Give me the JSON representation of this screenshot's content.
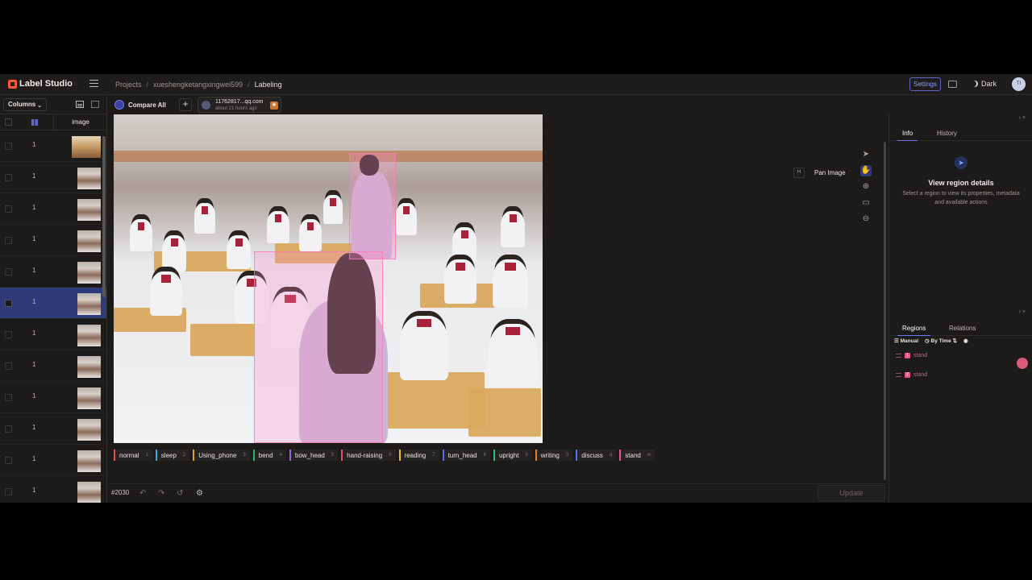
{
  "app": {
    "name": "Label Studio"
  },
  "breadcrumbs": [
    "Projects",
    "xueshengketangxingwei599",
    "Labeling"
  ],
  "header": {
    "settings_label": "Settings",
    "theme_label": "Dark",
    "user_initials": "TI"
  },
  "data_panel": {
    "columns_label": "Columns",
    "column_header": "image",
    "rows": [
      {
        "id": "1",
        "selected": false
      },
      {
        "id": "1",
        "selected": false
      },
      {
        "id": "1",
        "selected": false
      },
      {
        "id": "1",
        "selected": false
      },
      {
        "id": "1",
        "selected": false
      },
      {
        "id": "1",
        "selected": true
      },
      {
        "id": "1",
        "selected": false
      },
      {
        "id": "1",
        "selected": false
      },
      {
        "id": "1",
        "selected": false
      },
      {
        "id": "1",
        "selected": false
      },
      {
        "id": "1",
        "selected": false
      },
      {
        "id": "1",
        "selected": false
      }
    ]
  },
  "tabs": {
    "compare_label": "Compare All",
    "add_label": "+",
    "annotation": {
      "author": "11762817...qq.com",
      "time": "about 21 hours ago"
    }
  },
  "tool_hint": {
    "key": "H",
    "label": "Pan Image"
  },
  "labels": [
    {
      "name": "normal",
      "hotkey": "1",
      "color": "#e0504a"
    },
    {
      "name": "sleep",
      "hotkey": "2",
      "color": "#3aa8d8"
    },
    {
      "name": "Using_phone",
      "hotkey": "3",
      "color": "#e0a030"
    },
    {
      "name": "bend",
      "hotkey": "4",
      "color": "#30b060"
    },
    {
      "name": "bow_head",
      "hotkey": "5",
      "color": "#a060e0"
    },
    {
      "name": "hand-raising",
      "hotkey": "6",
      "color": "#e05070"
    },
    {
      "name": "reading",
      "hotkey": "7",
      "color": "#e8c030"
    },
    {
      "name": "turn_head",
      "hotkey": "8",
      "color": "#5a6ae0"
    },
    {
      "name": "upright",
      "hotkey": "9",
      "color": "#30c070"
    },
    {
      "name": "writing",
      "hotkey": "0",
      "color": "#e08030"
    },
    {
      "name": "discuss",
      "hotkey": "q",
      "color": "#4a7ae8"
    },
    {
      "name": "stand",
      "hotkey": "w",
      "color": "#e0568e"
    }
  ],
  "bottom": {
    "task_id": "#2030",
    "update_label": "Update"
  },
  "info_panel": {
    "tabs": [
      "Info",
      "History"
    ],
    "empty_title": "View region details",
    "empty_desc": "Select a region to view its properties, metadata and available actions"
  },
  "regions_panel": {
    "tabs": [
      "Regions",
      "Relations"
    ],
    "sort_manual": "Manual",
    "sort_time": "By Time",
    "regions": [
      {
        "label": "stand",
        "index": "1"
      },
      {
        "label": "stand",
        "index": "2"
      }
    ]
  }
}
